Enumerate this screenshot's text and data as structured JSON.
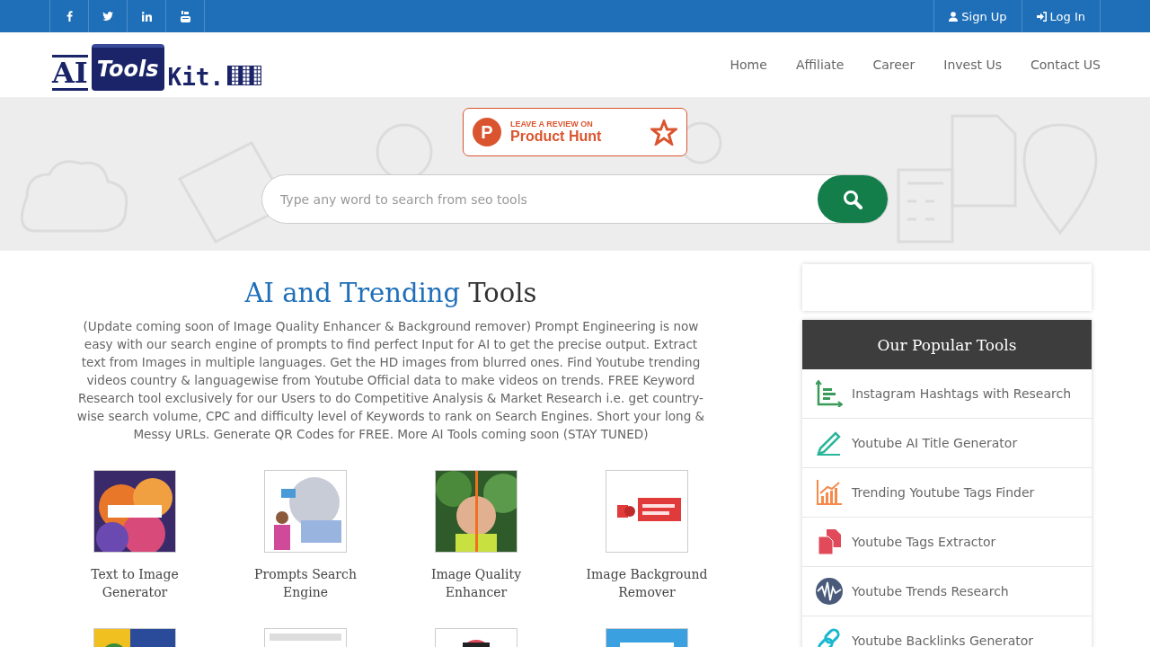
{
  "social_links": [
    {
      "kind": "facebook"
    },
    {
      "kind": "twitter"
    },
    {
      "kind": "linkedin"
    },
    {
      "kind": "youtube"
    }
  ],
  "account_links": [
    {
      "kind": "signup",
      "label": "Sign Up"
    },
    {
      "kind": "login",
      "label": "Log In"
    }
  ],
  "logo": {
    "word_1": "AI",
    "word_2": "Tools",
    "word_3": "Kit."
  },
  "nav": [
    {
      "label": "Home"
    },
    {
      "label": "Affiliate"
    },
    {
      "label": "Career"
    },
    {
      "label": "Invest Us"
    },
    {
      "label": "Contact US"
    }
  ],
  "review_badge": {
    "line_1": "LEAVE A REVIEW ON",
    "line_2": "Product Hunt",
    "mark": "P"
  },
  "search": {
    "placeholder": "Type any word to search from seo tools"
  },
  "heading": {
    "highlight": "AI and Trending",
    "rest": "Tools"
  },
  "intro": "(Update coming soon of Image Quality Enhancer & Background remover) Prompt Engineering is now easy with our search engine of prompts to find perfect Input for AI to get the precise output. Extract text from Images in multiple languages. Get the HD images from blurred ones. Find Youtube trending videos country & languagewise from Youtube Official data to make videos on trends. FREE Keyword Research tool exclusively for our Users to do Competitive Analysis & Market Research i.e. get country-wise search volume, CPC and difficulty level of Keywords to rank on Search Engines. Short your long & Messy URLs. Generate QR Codes for FREE. More AI Tools coming soon (STAY TUNED)",
  "tools": [
    {
      "name": "Text to Image Generator",
      "kind": "picture"
    },
    {
      "name": "Prompts Search Engine",
      "kind": "picture"
    },
    {
      "name": "Image Quality Enhancer",
      "kind": "picture"
    },
    {
      "name": "Image Background Remover",
      "kind": "picture"
    },
    {
      "kind": "picture"
    },
    {
      "kind": "picture"
    },
    {
      "kind": "picture"
    },
    {
      "kind": "picture"
    }
  ],
  "popular_tools": {
    "title": "Our Popular Tools",
    "items": [
      {
        "label": "Instagram Hashtags with Research"
      },
      {
        "label": "Youtube AI Title Generator"
      },
      {
        "label": "Trending Youtube Tags Finder"
      },
      {
        "label": "Youtube Tags Extractor"
      },
      {
        "label": "Youtube Trends Research"
      },
      {
        "label": "Youtube Backlinks Generator"
      }
    ]
  }
}
